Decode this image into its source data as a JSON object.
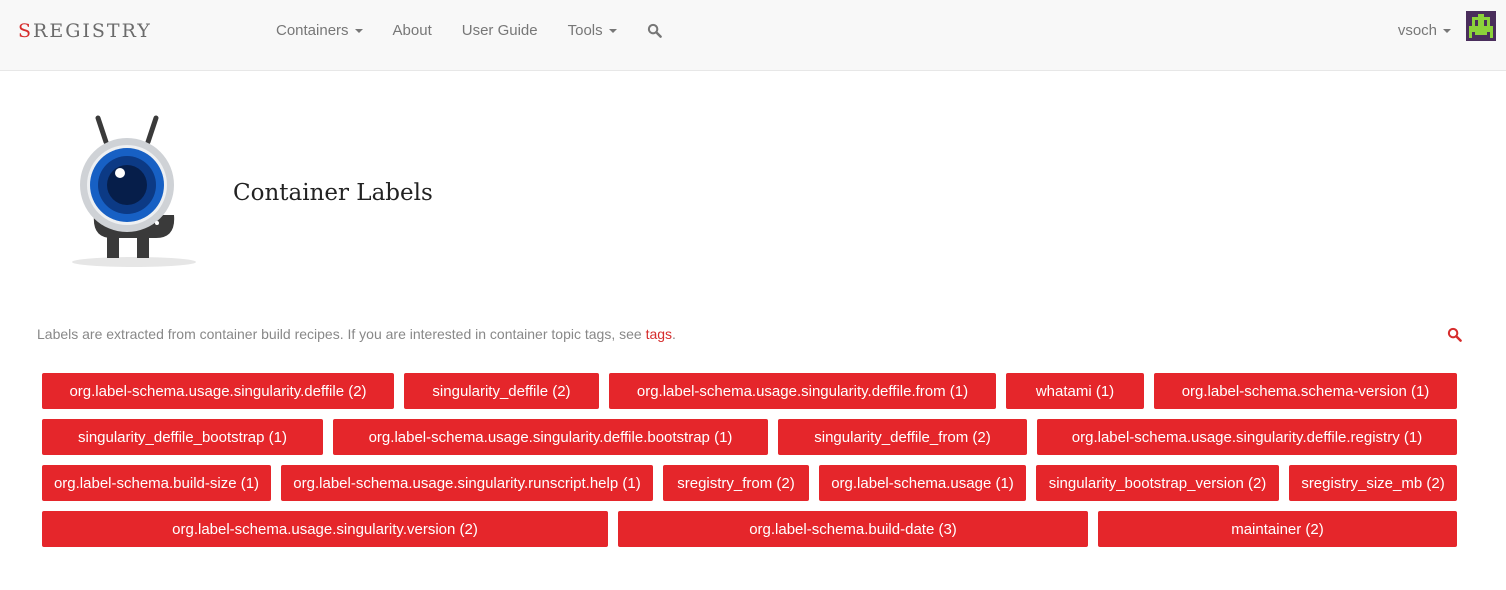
{
  "brand": {
    "first_letter": "S",
    "rest": "REGISTRY"
  },
  "nav": {
    "containers": "Containers",
    "about": "About",
    "user_guide": "User Guide",
    "tools": "Tools"
  },
  "user": {
    "name": "vsoch"
  },
  "page": {
    "title": "Container Labels"
  },
  "intro": {
    "text": "Labels are extracted from container build recipes. If you are interested in container topic tags, see ",
    "link": "tags",
    "end": "."
  },
  "colors": {
    "accent": "#e5262b",
    "brand_red": "#d62c2c",
    "navbar_bg": "#f8f8f8"
  },
  "labels": [
    [
      "org.label-schema.usage.singularity.deffile (2)",
      "singularity_deffile (2)",
      "org.label-schema.usage.singularity.deffile.from (1)",
      "whatami (1)",
      "org.label-schema.schema-version (1)"
    ],
    [
      "singularity_deffile_bootstrap (1)",
      "org.label-schema.usage.singularity.deffile.bootstrap (1)",
      "singularity_deffile_from (2)",
      "org.label-schema.usage.singularity.deffile.registry (1)"
    ],
    [
      "org.label-schema.build-size (1)",
      "org.label-schema.usage.singularity.runscript.help (1)",
      "sregistry_from (2)",
      "org.label-schema.usage (1)",
      "singularity_bootstrap_version (2)",
      "sregistry_size_mb (2)"
    ],
    [
      "org.label-schema.usage.singularity.version (2)",
      "org.label-schema.build-date (3)",
      "maintainer (2)"
    ]
  ]
}
